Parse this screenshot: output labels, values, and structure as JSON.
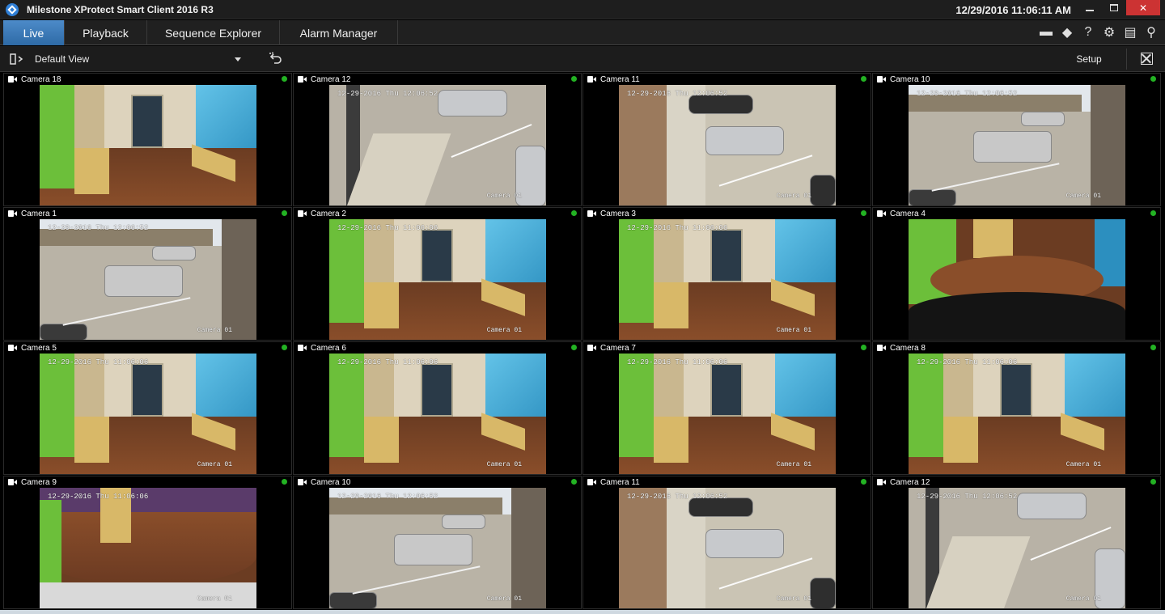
{
  "window": {
    "title": "Milestone XProtect Smart Client 2016 R3",
    "datetime": "12/29/2016 11:06:11 AM",
    "minimize_icon": "minimize-icon",
    "maximize_icon": "maximize-icon",
    "close_glyph": "✕"
  },
  "tabs": [
    {
      "label": "Live",
      "active": true
    },
    {
      "label": "Playback",
      "active": false
    },
    {
      "label": "Sequence Explorer",
      "active": false
    },
    {
      "label": "Alarm Manager",
      "active": false
    }
  ],
  "toolbar_icons": [
    {
      "name": "status-icon",
      "glyph": "▬"
    },
    {
      "name": "connection-icon",
      "glyph": "◆"
    },
    {
      "name": "help-icon",
      "glyph": "?"
    },
    {
      "name": "settings-icon",
      "glyph": "⚙"
    },
    {
      "name": "window-icon",
      "glyph": "▤"
    },
    {
      "name": "pin-icon",
      "glyph": "⚲"
    }
  ],
  "viewbar": {
    "selected_view": "Default View",
    "setup_label": "Setup"
  },
  "colors": {
    "accent": "#3d7cbf",
    "live_indicator": "#23b223",
    "close_button": "#cc3333"
  },
  "cameras": [
    {
      "name": "Camera 18",
      "timestamp": "",
      "osd_label": "",
      "scene": "office"
    },
    {
      "name": "Camera 12",
      "timestamp": "12-29-2016 Thu 12:06:52",
      "osd_label": "Camera 01",
      "scene": "corner"
    },
    {
      "name": "Camera 11",
      "timestamp": "12-29-2016 Thu 12:06:52",
      "osd_label": "Camera 01",
      "scene": "drive"
    },
    {
      "name": "Camera 10",
      "timestamp": "12-29-2016 Thu 12:06:52",
      "osd_label": "Camera 01",
      "scene": "lot"
    },
    {
      "name": "Camera 1",
      "timestamp": "12-29-2016 Thu 12:06:52",
      "osd_label": "Camera 01",
      "scene": "lot"
    },
    {
      "name": "Camera 2",
      "timestamp": "12-29-2016 Thu 11:06:06",
      "osd_label": "Camera 01",
      "scene": "office"
    },
    {
      "name": "Camera 3",
      "timestamp": "12-29-2016 Thu 11:06:06",
      "osd_label": "Camera 01",
      "scene": "office"
    },
    {
      "name": "Camera 4",
      "timestamp": "",
      "osd_label": "",
      "scene": "fisheye2"
    },
    {
      "name": "Camera 5",
      "timestamp": "12-29-2016 Thu 11:06:06",
      "osd_label": "Camera 01",
      "scene": "office"
    },
    {
      "name": "Camera 6",
      "timestamp": "12-29-2016 Thu 11:06:06",
      "osd_label": "Camera 01",
      "scene": "office"
    },
    {
      "name": "Camera 7",
      "timestamp": "12-29-2016 Thu 11:06:06",
      "osd_label": "Camera 01",
      "scene": "office"
    },
    {
      "name": "Camera 8",
      "timestamp": "12-29-2016 Thu 11:06:06",
      "osd_label": "Camera 01",
      "scene": "office"
    },
    {
      "name": "Camera 9",
      "timestamp": "12-29-2016 Thu 11:06:06",
      "osd_label": "Camera 01",
      "scene": "fisheye"
    },
    {
      "name": "Camera 10",
      "timestamp": "12-29-2016 Thu 12:06:52",
      "osd_label": "Camera 01",
      "scene": "lot"
    },
    {
      "name": "Camera 11",
      "timestamp": "12-29-2016 Thu 12:06:52",
      "osd_label": "Camera 01",
      "scene": "drive"
    },
    {
      "name": "Camera 12",
      "timestamp": "12-29-2016 Thu 12:06:52",
      "osd_label": "Camera 01",
      "scene": "corner"
    }
  ]
}
